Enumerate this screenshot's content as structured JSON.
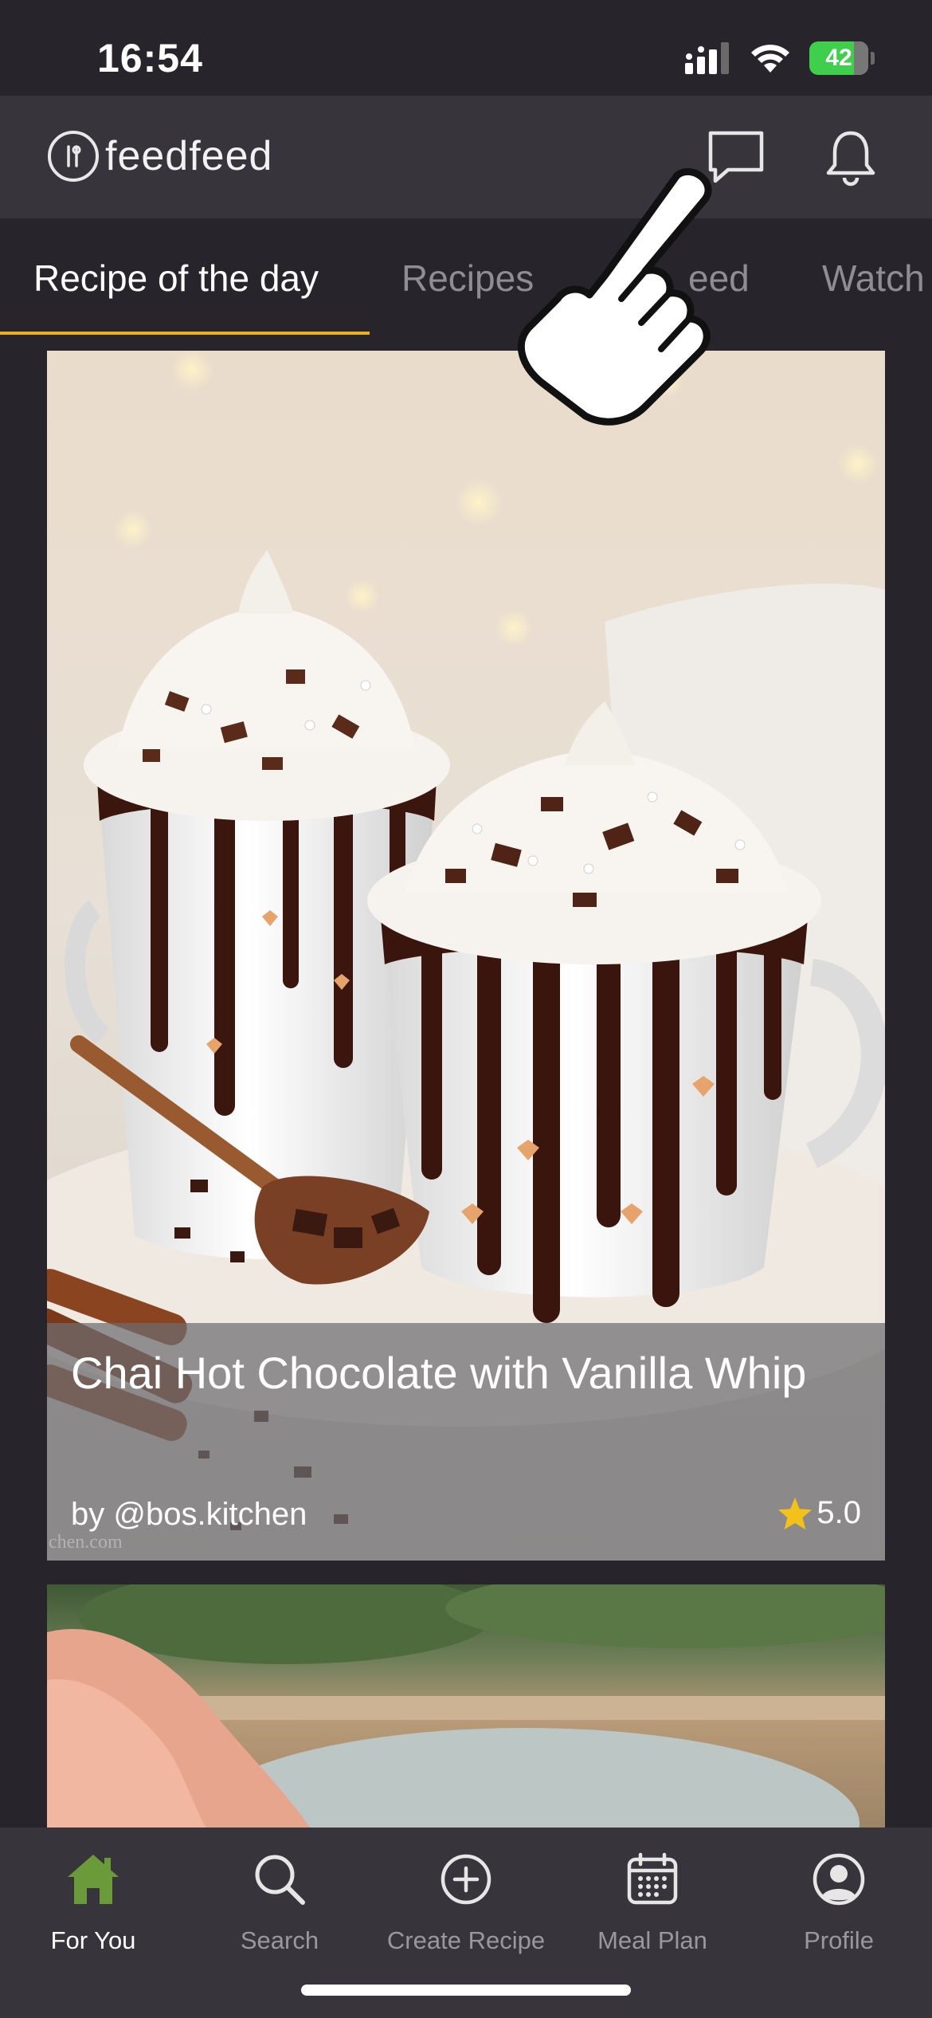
{
  "status_bar": {
    "time": "16:54",
    "battery": "42"
  },
  "header": {
    "logo_text": "feedfeed"
  },
  "tabs": [
    {
      "label": "Recipe of the day",
      "active": true
    },
    {
      "label": "Recipes"
    },
    {
      "label": "eed"
    },
    {
      "label": "Watch"
    }
  ],
  "recipe_card": {
    "title": "Chai Hot Chocolate with Vanilla Whip",
    "author": "by @bos.kitchen",
    "rating": "5.0",
    "watermark": "chen.com"
  },
  "tabbar": [
    {
      "label": "For You",
      "icon": "home-icon",
      "active": true
    },
    {
      "label": "Search",
      "icon": "search-icon"
    },
    {
      "label": "Create Recipe",
      "icon": "plus-circle-icon"
    },
    {
      "label": "Meal Plan",
      "icon": "calendar-icon"
    },
    {
      "label": "Profile",
      "icon": "user-circle-icon"
    }
  ],
  "colors": {
    "accent": "#e9b020",
    "active_tab_icon": "#6a9a3a",
    "background": "#27252b",
    "header": "#37353b"
  }
}
